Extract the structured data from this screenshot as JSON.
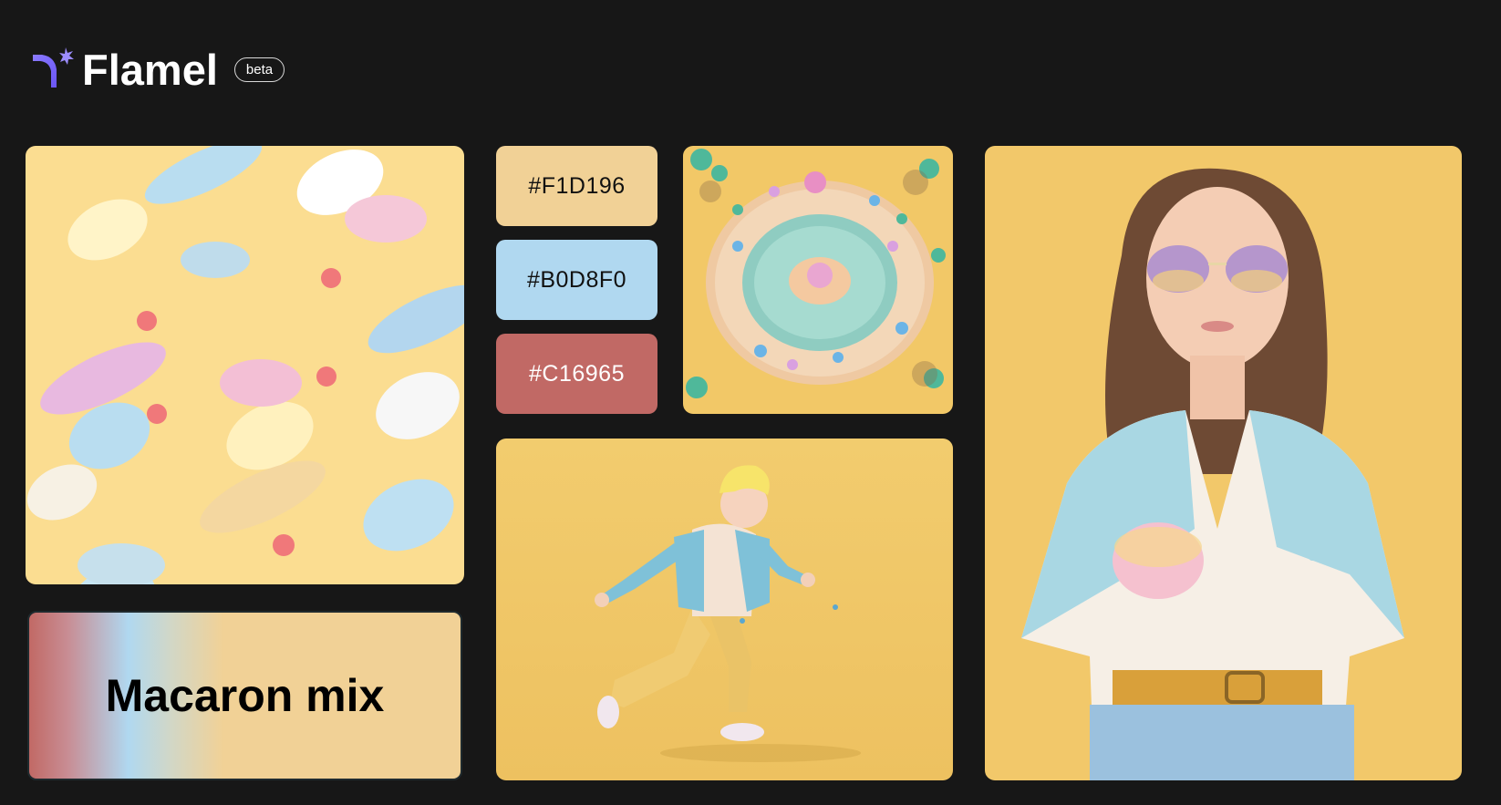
{
  "app": {
    "name": "Flamel",
    "badge": "beta",
    "logo_icon": "flamel-logo-icon"
  },
  "palette": {
    "name": "Macaron mix",
    "colors": [
      {
        "hex": "#F1D196",
        "label": "#F1D196",
        "text_color": "#111111"
      },
      {
        "hex": "#B0D8F0",
        "label": "#B0D8F0",
        "text_color": "#111111"
      },
      {
        "hex": "#C16965",
        "label": "#C16965",
        "text_color": "#ffffff"
      }
    ]
  },
  "images": [
    {
      "id": "marshmallow-pattern",
      "subject": "pastel marshmallows on yellow"
    },
    {
      "id": "island-pool",
      "subject": "pastel island pool with palm trees"
    },
    {
      "id": "running-boy",
      "subject": "3D running boy character"
    },
    {
      "id": "woman-portrait",
      "subject": "woman in pastel shirt and sunglasses"
    }
  ]
}
